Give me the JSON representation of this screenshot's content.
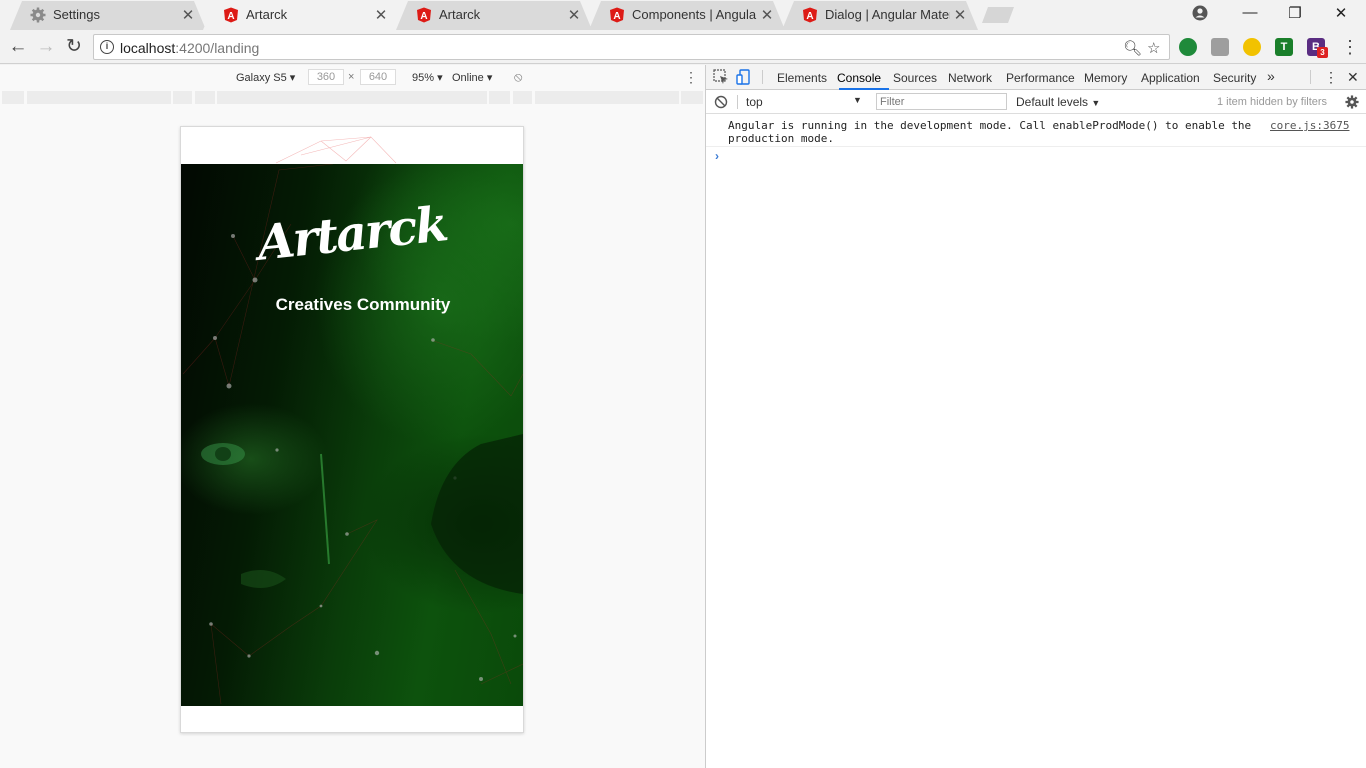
{
  "tabs": [
    {
      "title": "Settings",
      "icon": "gear-icon",
      "active": false
    },
    {
      "title": "Artarck",
      "icon": "angular-icon",
      "active": true
    },
    {
      "title": "Artarck",
      "icon": "angular-icon",
      "active": false
    },
    {
      "title": "Components | Angular M",
      "icon": "angular-icon",
      "active": false
    },
    {
      "title": "Dialog | Angular Material",
      "icon": "angular-icon",
      "active": false
    }
  ],
  "tab_close": "✕",
  "window": {
    "minimize": "—",
    "restore": "❐",
    "close": "✕"
  },
  "omnibox": {
    "url_host": "localhost",
    "url_rest": ":4200/landing"
  },
  "extensions": [
    {
      "name": "extension-green-icon",
      "label": "",
      "color": "#1f8a3a"
    },
    {
      "name": "extension-angular-icon",
      "label": "",
      "color": "#9e9e9e"
    },
    {
      "name": "extension-moon-icon",
      "label": "",
      "color": "#f2c200"
    },
    {
      "name": "extension-t-icon",
      "label": "T",
      "color": "#1a7f2a"
    },
    {
      "name": "extension-b-icon",
      "label": "B",
      "color": "#5a2d82",
      "badge": "3"
    }
  ],
  "device_toolbar": {
    "device": "Galaxy S5",
    "width": "360",
    "height": "640",
    "x_separator": "×",
    "zoom": "95%",
    "network": "Online"
  },
  "app": {
    "logo": "Artarck",
    "tagline": "Creatives Community"
  },
  "devtools": {
    "tabs": [
      "Elements",
      "Console",
      "Sources",
      "Network",
      "Performance",
      "Memory",
      "Application",
      "Security"
    ],
    "active_tab": "Console",
    "more": "»",
    "context": "top",
    "filter_placeholder": "Filter",
    "levels": "Default levels",
    "hidden_note": "1 item hidden by filters",
    "message": "Angular is running in the development mode. Call enableProdMode() to enable the production mode.",
    "message_source": "core.js:3675",
    "prompt": "›"
  },
  "colors": {
    "angular_red": "#dd1b16",
    "accent_blue": "#1a73e8"
  }
}
